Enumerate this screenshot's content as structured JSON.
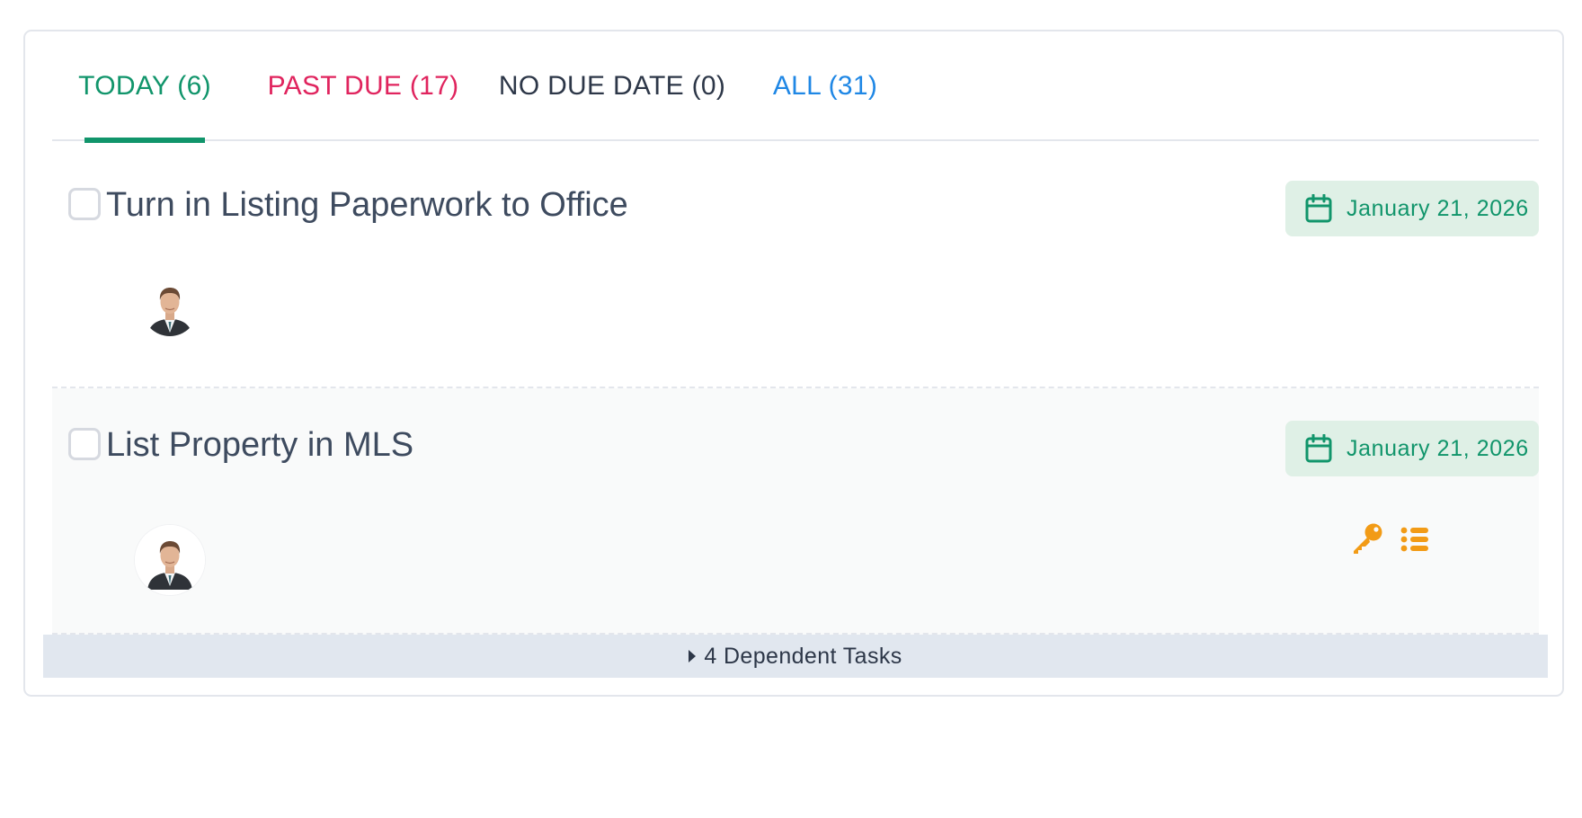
{
  "tabs": [
    {
      "label": "TODAY (6)",
      "color": "#11956b",
      "active": true
    },
    {
      "label": "PAST DUE (17)",
      "color": "#e0245e",
      "active": false
    },
    {
      "label": "NO DUE DATE (0)",
      "color": "#2d3748",
      "active": false
    },
    {
      "label": "ALL (31)",
      "color": "#1f87e5",
      "active": false
    }
  ],
  "tasks": [
    {
      "title": "Turn in Listing Paperwork to Office",
      "due_date": "January 21, 2026",
      "assignee_icon": "avatar-photo",
      "actions": []
    },
    {
      "title": "List Property in MLS",
      "due_date": "January 21, 2026",
      "assignee_icon": "avatar-photo",
      "actions": [
        "key-icon",
        "list-icon"
      ]
    }
  ],
  "dependent_tasks": {
    "label": "4 Dependent Tasks"
  },
  "colors": {
    "accent_green": "#11956b",
    "date_pill_bg": "#dff0e6",
    "action_orange": "#f29b16",
    "dependent_bar_bg": "#e1e7ef"
  }
}
